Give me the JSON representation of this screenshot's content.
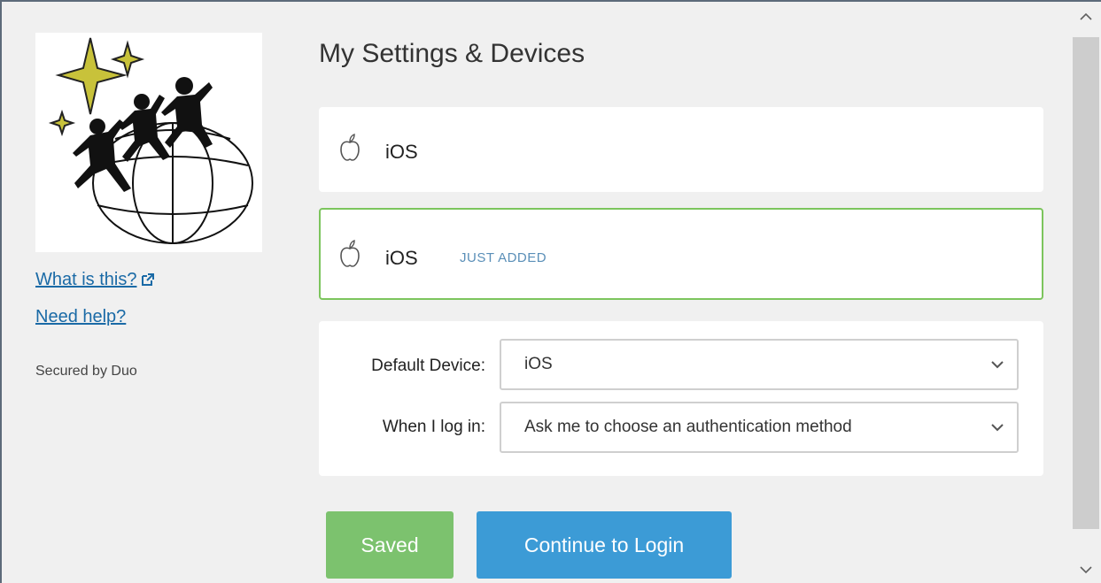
{
  "sidebar": {
    "links": {
      "what_is_this": "What is this?",
      "need_help": "Need help?"
    },
    "secured_by": "Secured by Duo"
  },
  "main": {
    "title": "My Settings & Devices",
    "devices": [
      {
        "name": "iOS",
        "badge": ""
      },
      {
        "name": "iOS",
        "badge": "JUST ADDED"
      }
    ],
    "settings": {
      "default_device_label": "Default Device:",
      "default_device_value": "iOS",
      "when_login_label": "When I log in:",
      "when_login_value": "Ask me to choose an authentication method"
    },
    "buttons": {
      "saved": "Saved",
      "continue": "Continue to Login"
    }
  },
  "colors": {
    "saved_button": "#7cc26e",
    "continue_button": "#3c9bd6",
    "selected_border": "#7cc55d",
    "link": "#1a6aa6",
    "badge": "#5a8fb8"
  },
  "icons": [
    "logo-image",
    "external-link-icon",
    "apple-icon",
    "chevron-down-icon",
    "scroll-up-icon",
    "scroll-down-icon"
  ]
}
